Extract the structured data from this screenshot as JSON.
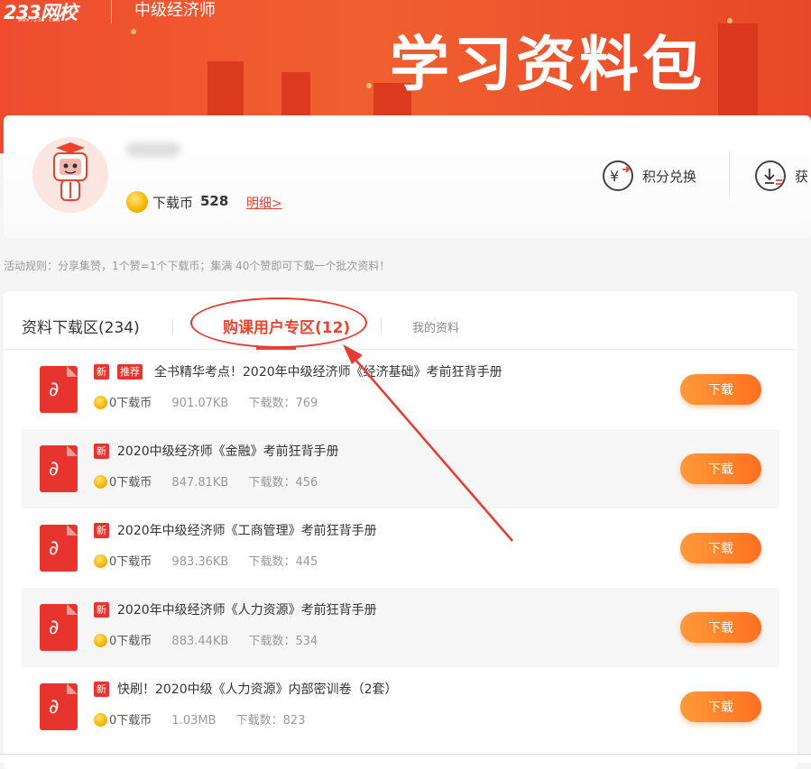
{
  "banner": {
    "logo": "233网校",
    "logo_url_text": "www.233.com",
    "subject": "中级经济师",
    "title": "学习资料包"
  },
  "profile": {
    "coin_label": "下载币",
    "coin_count": "528",
    "detail_link": "明细>",
    "actions": [
      {
        "label": "积分兑换",
        "icon": "yuan-exchange-icon"
      },
      {
        "label": "获",
        "icon": "download-list-icon"
      }
    ]
  },
  "rules_text": "活动规则：分享集赞，1个赞=1个下载币；集满 40个赞即可下载一个批次资料！",
  "tabs": [
    {
      "label": "资料下载区(234)",
      "active": false
    },
    {
      "label": "购课用户专区(12)",
      "active": true
    },
    {
      "label": "我的资料",
      "active": false
    }
  ],
  "items": [
    {
      "badges": [
        "新",
        "推荐"
      ],
      "title": "全书精华考点！2020年中级经济师《经济基础》考前狂背手册",
      "price": "0下载币",
      "size": "901.07KB",
      "downloads": "下载数：769",
      "button": "下载"
    },
    {
      "badges": [
        "新"
      ],
      "title": "2020中级经济师《金融》考前狂背手册",
      "price": "0下载币",
      "size": "847.81KB",
      "downloads": "下载数：456",
      "button": "下载"
    },
    {
      "badges": [
        "新"
      ],
      "title": "2020年中级经济师《工商管理》考前狂背手册",
      "price": "0下载币",
      "size": "983.36KB",
      "downloads": "下载数：445",
      "button": "下载"
    },
    {
      "badges": [
        "新"
      ],
      "title": "2020年中级经济师《人力资源》考前狂背手册",
      "price": "0下载币",
      "size": "883.44KB",
      "downloads": "下载数：534",
      "button": "下载"
    },
    {
      "badges": [
        "新"
      ],
      "title": "快刷！2020中级《人力资源》内部密训卷（2套）",
      "price": "0下载币",
      "size": "1.03MB",
      "downloads": "下载数：823",
      "button": "下载"
    }
  ],
  "colors": {
    "brand": "#e8442e",
    "button": "#ff7f2a",
    "annotation": "#e63a33"
  }
}
